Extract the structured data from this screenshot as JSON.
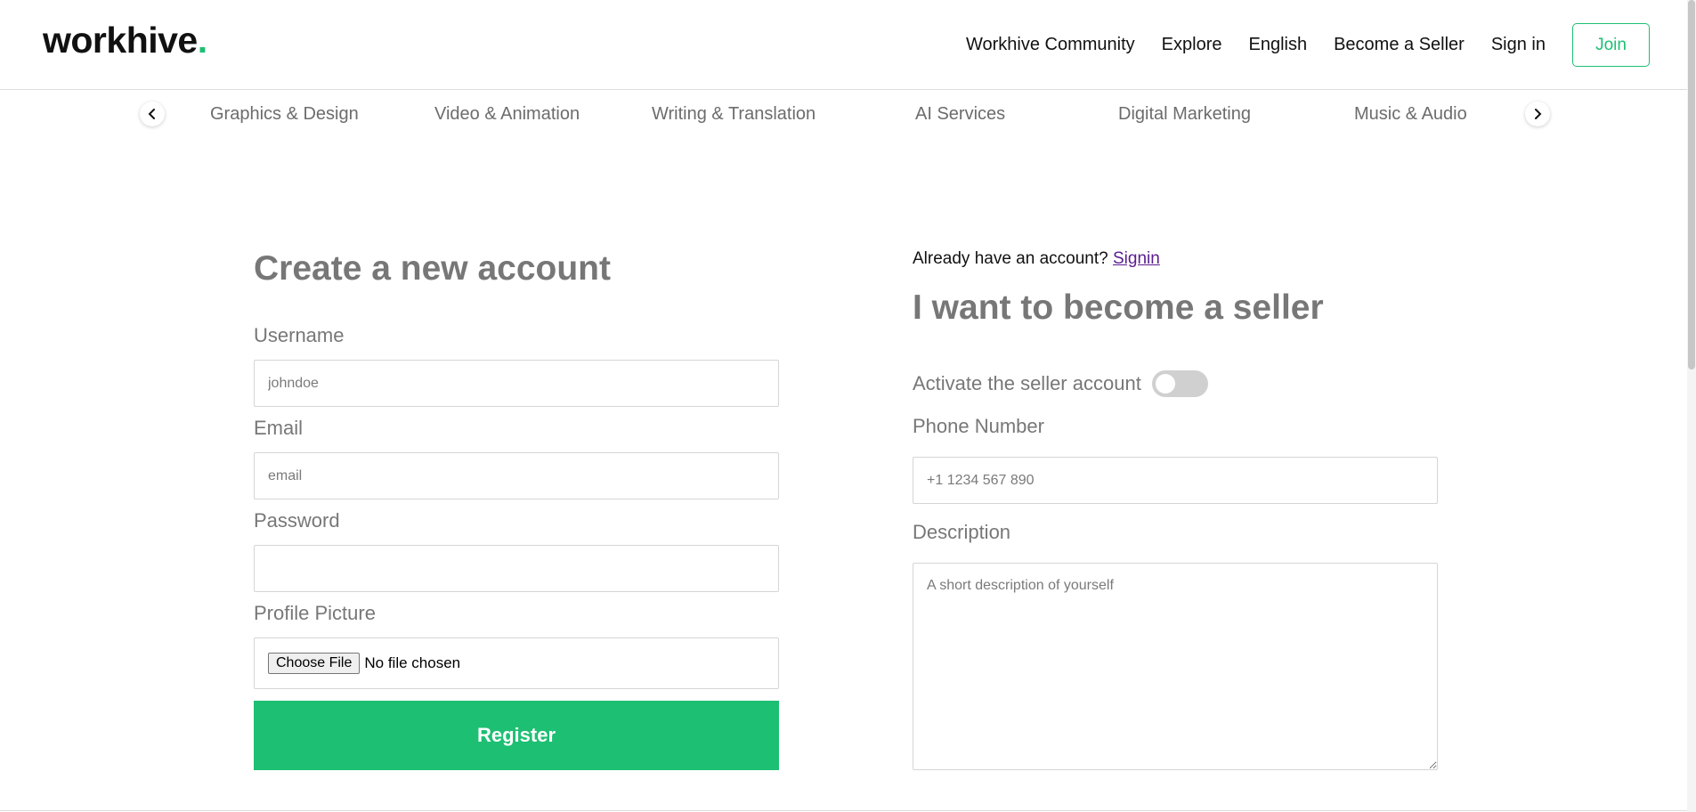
{
  "header": {
    "logo_text": "workhive",
    "logo_dot": ".",
    "nav": [
      "Workhive Community",
      "Explore",
      "English",
      "Become a Seller",
      "Sign in"
    ],
    "join_label": "Join"
  },
  "categories": {
    "items": [
      "Graphics & Design",
      "Video & Animation",
      "Writing & Translation",
      "AI Services",
      "Digital Marketing",
      "Music & Audio"
    ],
    "prev_icon": "chevron-left-icon",
    "next_icon": "chevron-right-icon"
  },
  "register_form": {
    "title": "Create a new account",
    "username_label": "Username",
    "username_placeholder": "johndoe",
    "email_label": "Email",
    "email_placeholder": "email",
    "password_label": "Password",
    "picture_label": "Profile Picture",
    "choose_file_label": "Choose File",
    "file_status": "No file chosen",
    "register_label": "Register"
  },
  "seller_form": {
    "already_text": "Already have an account?",
    "signin_link": "Signin",
    "title": "I want to become a seller",
    "activate_label": "Activate the seller account",
    "activate_on": false,
    "phone_label": "Phone Number",
    "phone_placeholder": "+1 1234 567 890",
    "description_label": "Description",
    "description_placeholder": "A short description of yourself"
  },
  "colors": {
    "accent": "#1dbf73",
    "muted_text": "#777777",
    "link_visited": "#5a1d8f"
  }
}
